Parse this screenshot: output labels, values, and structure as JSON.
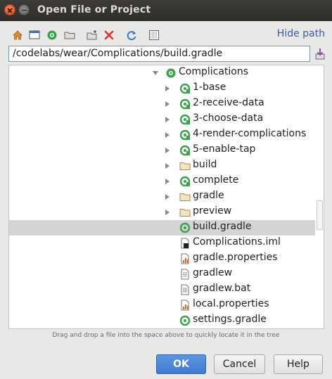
{
  "window": {
    "title": "Open File or Project"
  },
  "toolbar": {
    "icons": [
      "home-icon",
      "desktop-icon",
      "project-icon",
      "folder-icon",
      "new-folder-icon",
      "delete-icon",
      "refresh-icon",
      "show-hidden-icon"
    ],
    "hide_path": "Hide path",
    "download_icon": "download-icon"
  },
  "path": {
    "value": "/codelabs/wear/Complications/build.gradle"
  },
  "tree": {
    "root": {
      "label": "Complications",
      "icon": "android-module-icon",
      "expanded": true
    },
    "items": [
      {
        "label": "1-base",
        "icon": "module-icon",
        "expandable": true
      },
      {
        "label": "2-receive-data",
        "icon": "module-icon",
        "expandable": true
      },
      {
        "label": "3-choose-data",
        "icon": "module-icon",
        "expandable": true
      },
      {
        "label": "4-render-complications",
        "icon": "module-icon",
        "expandable": true
      },
      {
        "label": "5-enable-tap",
        "icon": "module-icon",
        "expandable": true
      },
      {
        "label": "build",
        "icon": "folder-icon",
        "expandable": true
      },
      {
        "label": "complete",
        "icon": "module-icon",
        "expandable": true
      },
      {
        "label": "gradle",
        "icon": "folder-icon",
        "expandable": true
      },
      {
        "label": "preview",
        "icon": "folder-icon",
        "expandable": true
      },
      {
        "label": "build.gradle",
        "icon": "gradle-file-icon",
        "expandable": false,
        "selected": true
      },
      {
        "label": "Complications.iml",
        "icon": "iml-file-icon",
        "expandable": false
      },
      {
        "label": "gradle.properties",
        "icon": "properties-file-icon",
        "expandable": false
      },
      {
        "label": "gradlew",
        "icon": "text-file-icon",
        "expandable": false
      },
      {
        "label": "gradlew.bat",
        "icon": "text-file-icon",
        "expandable": false
      },
      {
        "label": "local.properties",
        "icon": "properties-file-icon",
        "expandable": false
      },
      {
        "label": "settings.gradle",
        "icon": "gradle-file-icon",
        "expandable": false
      }
    ]
  },
  "hint": "Drag and drop a file into the space above to quickly locate it in the tree",
  "buttons": {
    "ok": "OK",
    "cancel": "Cancel",
    "help": "Help"
  },
  "colors": {
    "accent": "#3d7bd3",
    "link": "#3b5aa4",
    "selection": "#d4d4d4",
    "module_green": "#3aa34a",
    "folder_tan": "#c9a25a"
  }
}
